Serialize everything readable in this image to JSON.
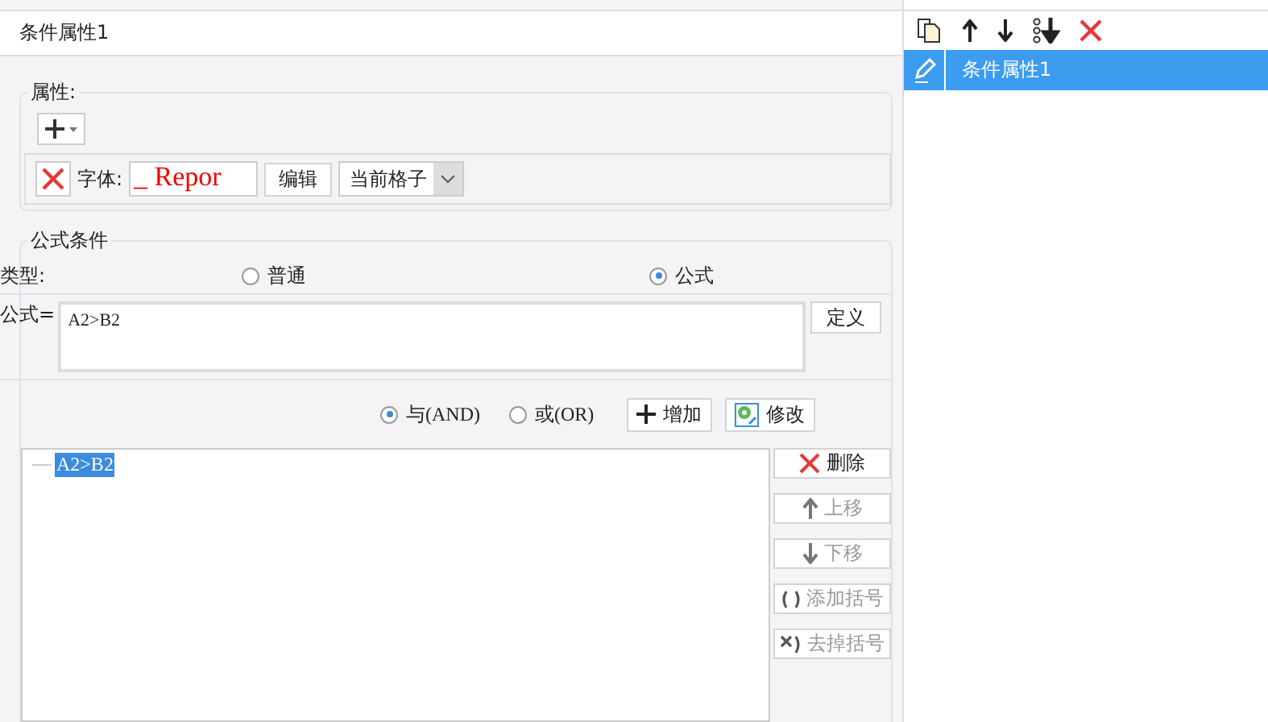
{
  "panel_title": "条件属性1",
  "properties": {
    "legend": "属性:",
    "font_row": {
      "label": "字体:",
      "preview": "_ Repor",
      "edit_button": "编辑",
      "scope": "当前格子"
    }
  },
  "formula_condition": {
    "legend": "公式条件",
    "type_label": "类型:",
    "types": [
      {
        "label": "普通",
        "selected": false
      },
      {
        "label": "公式",
        "selected": true
      }
    ],
    "formula_label": "公式=",
    "formula_value": "A2>B2",
    "define_button": "定义",
    "logic": [
      {
        "label": "与(AND)",
        "selected": true
      },
      {
        "label": "或(OR)",
        "selected": false
      }
    ],
    "add_button": "增加",
    "modify_button": "修改",
    "conditions": [
      {
        "text": "A2>B2",
        "selected": true
      }
    ],
    "side_buttons": [
      {
        "label": "删除",
        "kind": "delete",
        "disabled": false
      },
      {
        "label": "上移",
        "kind": "up",
        "disabled": true
      },
      {
        "label": "下移",
        "kind": "down",
        "disabled": true
      },
      {
        "label": "添加括号",
        "kind": "add-paren",
        "disabled": true
      },
      {
        "label": "去掉括号",
        "kind": "remove-paren",
        "disabled": true
      }
    ]
  },
  "condition_list": {
    "items": [
      {
        "label": "条件属性1",
        "selected": true
      }
    ]
  }
}
